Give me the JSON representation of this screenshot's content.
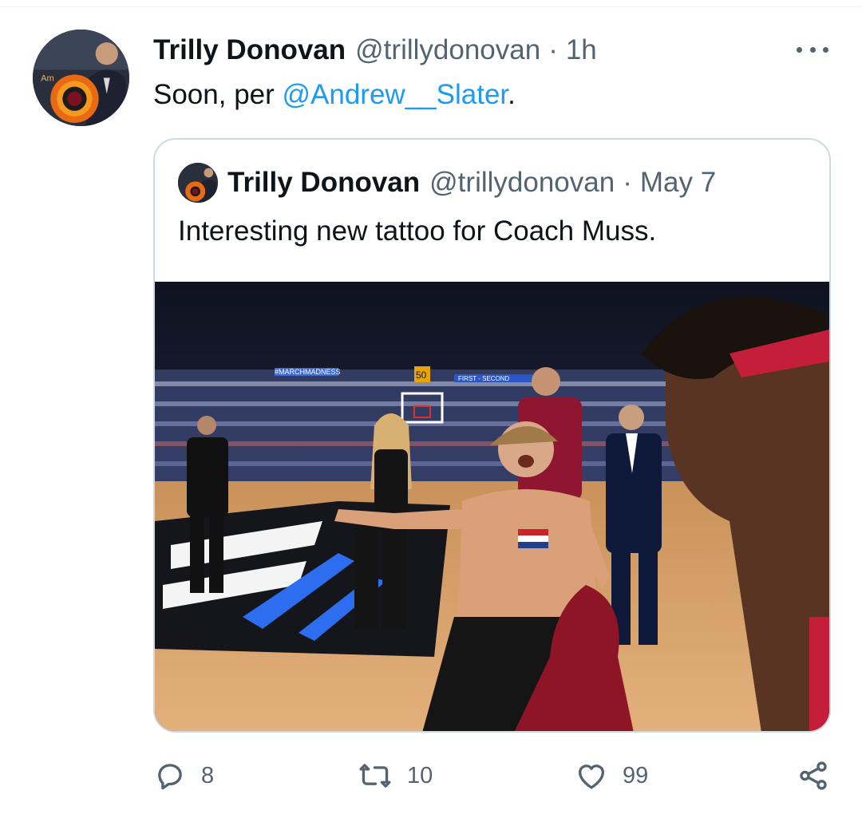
{
  "tweet": {
    "author_name": "Trilly Donovan",
    "author_handle": "@trillydonovan",
    "separator": "·",
    "time": "1h",
    "text_before": "Soon, per ",
    "mention": "@Andrew__Slater",
    "text_after": "."
  },
  "quoted_tweet": {
    "author_name": "Trilly Donovan",
    "author_handle": "@trillydonovan",
    "separator": "·",
    "date": "May 7",
    "text": "Interesting new tattoo for Coach Muss.",
    "media": {
      "banner_text": "#MARCHMADNESS",
      "scoreboard_text": "50",
      "ribbon_text": "FIRST - SECOND"
    }
  },
  "actions": {
    "replies": "8",
    "retweets": "10",
    "likes": "99"
  },
  "icons": [
    "more-icon",
    "reply-icon",
    "retweet-icon",
    "like-icon",
    "share-icon"
  ],
  "colors": {
    "link": "#1d9bf0",
    "secondary_text": "#536471",
    "border": "#cfd9de"
  }
}
